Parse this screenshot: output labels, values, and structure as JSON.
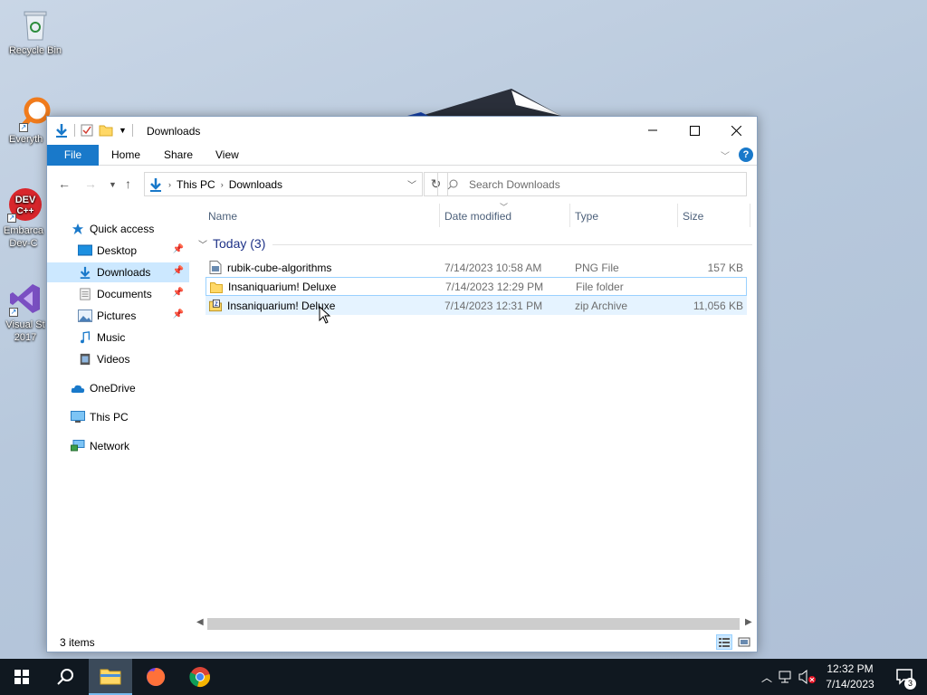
{
  "desktop": {
    "icons": [
      {
        "label": "Recycle Bin"
      },
      {
        "label": "Everyth"
      },
      {
        "label": "Embarca Dev-C"
      },
      {
        "label": "Visual St 2017"
      }
    ]
  },
  "window": {
    "title": "Downloads",
    "ribbon_tabs": [
      "File",
      "Home",
      "Share",
      "View"
    ],
    "address": {
      "crumbs": [
        "This PC",
        "Downloads"
      ]
    },
    "search": {
      "placeholder": "Search Downloads"
    },
    "nav": {
      "items": [
        {
          "label": "Quick access",
          "icon": "star-icon"
        },
        {
          "label": "Desktop",
          "icon": "desktop-icon",
          "pinned": true
        },
        {
          "label": "Downloads",
          "icon": "download-icon",
          "pinned": true,
          "selected": true
        },
        {
          "label": "Documents",
          "icon": "documents-icon",
          "pinned": true
        },
        {
          "label": "Pictures",
          "icon": "pictures-icon",
          "pinned": true
        },
        {
          "label": "Music",
          "icon": "music-icon"
        },
        {
          "label": "Videos",
          "icon": "videos-icon"
        },
        {
          "label": "OneDrive",
          "icon": "cloud-icon"
        },
        {
          "label": "This PC",
          "icon": "computer-icon"
        },
        {
          "label": "Network",
          "icon": "network-icon"
        }
      ]
    },
    "columns": [
      "Name",
      "Date modified",
      "Type",
      "Size"
    ],
    "group_label": "Today (3)",
    "files": [
      {
        "name": "rubik-cube-algorithms",
        "date": "7/14/2023 10:58 AM",
        "type": "PNG File",
        "size": "157 KB",
        "icon": "image-file-icon"
      },
      {
        "name": "Insaniquarium! Deluxe",
        "date": "7/14/2023 12:29 PM",
        "type": "File folder",
        "size": "",
        "icon": "folder-icon"
      },
      {
        "name": "Insaniquarium! Deluxe",
        "date": "7/14/2023 12:31 PM",
        "type": "zip Archive",
        "size": "11,056 KB",
        "icon": "zip-file-icon"
      }
    ],
    "status": {
      "item_count": "3 items"
    }
  },
  "taskbar": {
    "clock_time": "12:32 PM",
    "clock_date": "7/14/2023",
    "notification_count": "3"
  },
  "colors": {
    "accent": "#1979ca",
    "selection": "#cce8ff",
    "taskbar": "#101820"
  }
}
